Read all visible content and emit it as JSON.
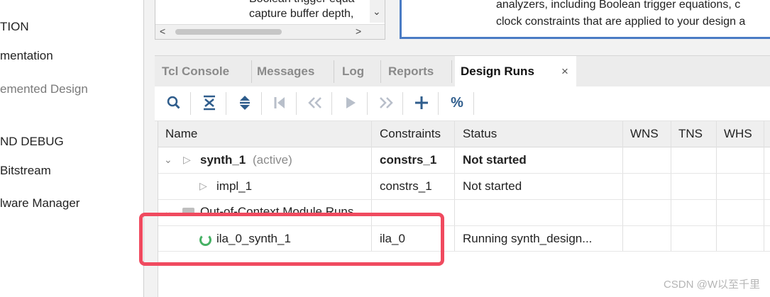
{
  "left_nav": {
    "items": [
      {
        "label": "TION",
        "style": "normal"
      },
      {
        "label": "mentation",
        "style": "normal"
      },
      {
        "label": "emented Design",
        "style": "gray"
      },
      {
        "label": "ND DEBUG",
        "style": "normal"
      },
      {
        "label": "Bitstream",
        "style": "normal"
      },
      {
        "label": "lware Manager",
        "style": "normal"
      }
    ]
  },
  "text_pane": {
    "lines": [
      "Boolean trigger equa",
      "capture buffer depth,"
    ]
  },
  "info_box": {
    "lines": [
      "analyzers, including Boolean trigger equations, c",
      "clock constraints that are applied to your design a"
    ]
  },
  "tabs": {
    "items": [
      "Tcl Console",
      "Messages",
      "Log",
      "Reports"
    ],
    "active": "Design Runs",
    "close_symbol": "×"
  },
  "toolbar": {
    "buttons": [
      {
        "name": "search",
        "glyph": "🔍",
        "enabled": true
      },
      {
        "name": "collapse-all",
        "glyph": "⇟",
        "enabled": true
      },
      {
        "name": "expand-all",
        "glyph": "⇕",
        "enabled": true
      },
      {
        "name": "first",
        "glyph": "⏮",
        "enabled": false
      },
      {
        "name": "previous",
        "glyph": "«",
        "enabled": false
      },
      {
        "name": "launch",
        "glyph": "▶",
        "enabled": false
      },
      {
        "name": "next",
        "glyph": "»",
        "enabled": false
      },
      {
        "name": "add",
        "glyph": "+",
        "enabled": true
      },
      {
        "name": "percent",
        "glyph": "%",
        "enabled": true
      }
    ]
  },
  "runs_table": {
    "columns": [
      "Name",
      "Constraints",
      "Status",
      "WNS",
      "TNS",
      "WHS"
    ],
    "rows": [
      {
        "name": "synth_1",
        "suffix": "(active)",
        "constraints": "constrs_1",
        "status": "Not started"
      },
      {
        "name": "impl_1",
        "constraints": "constrs_1",
        "status": "Not started"
      },
      {
        "name": "Out-of-Context Module Runs"
      },
      {
        "name": "ila_0_synth_1",
        "constraints": "ila_0",
        "status": "Running synth_design..."
      }
    ]
  },
  "watermark": "CSDN @W以至千里",
  "colors": {
    "highlight": "#f04a5f",
    "info_border": "#4a7bc4",
    "spinner": "#46b164",
    "toolbar_icon": "#2f5d8c"
  }
}
